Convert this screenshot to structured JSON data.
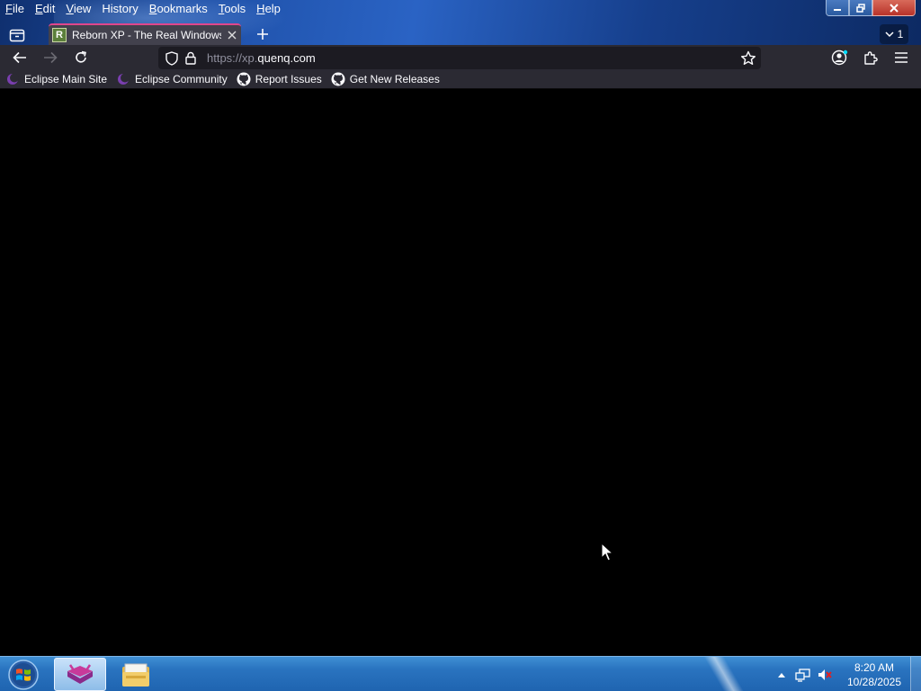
{
  "menu": {
    "items": [
      {
        "label": "File",
        "accel": "F",
        "rest": "ile"
      },
      {
        "label": "Edit",
        "accel": "E",
        "rest": "dit"
      },
      {
        "label": "View",
        "accel": "V",
        "rest": "iew"
      },
      {
        "label": "History",
        "accel": "",
        "rest": "History"
      },
      {
        "label": "Bookmarks",
        "accel": "B",
        "rest": "ookmarks"
      },
      {
        "label": "Tools",
        "accel": "T",
        "rest": "ools"
      },
      {
        "label": "Help",
        "accel": "H",
        "rest": "elp"
      }
    ]
  },
  "tabs": {
    "active_title": "Reborn XP - The Real Windows XP",
    "favicon_letter": "R",
    "overflow_count": "1"
  },
  "urlbar": {
    "url_prefix": "https://xp.",
    "url_host": "quenq.com"
  },
  "bookmarks": [
    {
      "label": "Eclipse Main Site",
      "icon": "eclipse-icon"
    },
    {
      "label": "Eclipse Community",
      "icon": "eclipse-icon"
    },
    {
      "label": "Report Issues",
      "icon": "github-icon"
    },
    {
      "label": "Get New Releases",
      "icon": "github-icon"
    }
  ],
  "taskbar": {
    "clock_time": "8:20 AM",
    "clock_date": "10/28/2025"
  },
  "colors": {
    "tab_accent": "#e0468c",
    "toolbar_bg": "#2b2a33",
    "content_bg": "#000000",
    "taskbar": "#2a74c0"
  }
}
